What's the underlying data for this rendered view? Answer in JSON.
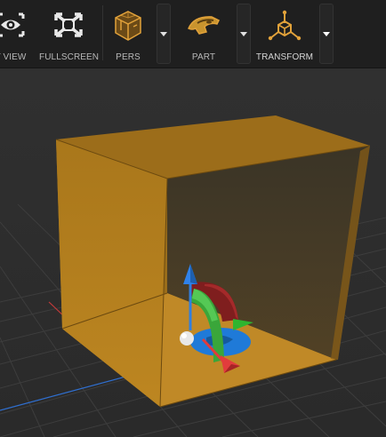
{
  "toolbar": {
    "items": [
      {
        "label": "T VIEW",
        "icon": "eye-icon"
      },
      {
        "label": "FULLSCREEN",
        "icon": "fullscreen-icon"
      },
      {
        "label": "PERS",
        "icon": "perspective-cube-icon"
      },
      {
        "label": "PART",
        "icon": "part-icon"
      },
      {
        "label": "TRANSFORM",
        "icon": "transform-gizmo-icon"
      }
    ]
  },
  "colors": {
    "toolbar_bg": "#1f1f1f",
    "viewport_bg": "#2f2f2f",
    "accent_orange": "#e2a23a",
    "box_front": "#b07d1c",
    "box_top": "#9c6d1a",
    "box_inner_floor": "#c28a2a",
    "axis_x": "#e03b3b",
    "axis_y": "#39b54a",
    "axis_z": "#2f7fe0"
  }
}
